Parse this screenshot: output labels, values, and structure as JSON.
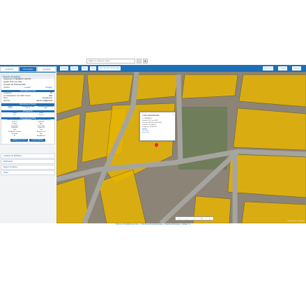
{
  "header": {
    "search_placeholder": "Digite um endereço, bairro...",
    "search_icon": "search-icon",
    "target_icon": "crosshair-icon"
  },
  "sidebar": {
    "tabs": [
      {
        "label": "GeoPortal"
      },
      {
        "label": "Informações"
      },
      {
        "label": "Consultas"
      }
    ],
    "panel_title": "Cadastro Imobiliário",
    "summary": [
      "Loteamento: LOTEAMENTO CENTRO",
      "Quadra: 0279, Lote: 0022",
      "Inscrição: 001.0279.0022.0000"
    ],
    "tools_label": "Cadastro",
    "tool_links": [
      "Localizar",
      "Visualizar"
    ],
    "info_head": "Informações do Lote",
    "info_rows": [
      {
        "label": "Logradouro",
        "value": "AV"
      },
      {
        "label": "AV PRESIDENTE COLOMBO SOUZA",
        "value": "1000"
      },
      {
        "label": "Bairro",
        "value": "Complemento"
      },
      {
        "label": "CENTRO",
        "value": "SALAS COMERCIAIS"
      }
    ],
    "dims_head": "Dimensões do Terreno",
    "dims_cols": [
      "Área",
      "Testada Principal",
      "Testadas Secundárias"
    ],
    "dims_vals": [
      "12450,5",
      "130,1",
      "48,8"
    ],
    "zone_head": "Zoneamento",
    "zone_cols": [
      "Zona",
      "Setor"
    ],
    "zone_vals": [
      "ZC1",
      "Central"
    ],
    "build_head": "Informações Prediais",
    "build_cols": [
      "Área construída (m²)",
      "Área Total Construída (m²)"
    ],
    "build_rows": [
      [
        "4758,77",
        "4860,95"
      ],
      [
        "Padrão",
        "Alto"
      ],
      [
        "Ocupação",
        "Construído"
      ],
      [
        "Utilização",
        "Comercial"
      ],
      [
        "Tipo",
        "Loja"
      ],
      [
        "Estado de Conserv.",
        "Regular 0,70"
      ],
      [
        "Elevador",
        "Sim"
      ],
      [
        "Ar",
        "ALVARÁ OK"
      ]
    ],
    "buttons": [
      "Detalhes do imóvel",
      "Imprimir Boletim"
    ],
    "accordion": [
      "Cadastro de Mobiliário",
      "Edificações",
      "Mapas Temáticos",
      "Rotas"
    ]
  },
  "map": {
    "tools": [
      "Imagem",
      "Satélite",
      "Mapa",
      "Ruas",
      "INDICADORES MUNICIPAIS"
    ],
    "right_tools": [
      "Vista aérea",
      "Camadas",
      "Legenda"
    ],
    "attribution": "Leaflet | Dados © Prefeitura",
    "popup": {
      "title": "Lote selecionado",
      "lines": [
        "LOTEAMENTO",
        "Quadra 0279, Lote 0022",
        "Inscrição 001.0279.0022.0000",
        "Latitude -23.1523451",
        "Longitude -45.8807711"
      ],
      "links": [
        "Ampliar",
        "Ver Ficha",
        "Street View"
      ]
    },
    "zoom": [
      "+",
      "−",
      "⌂",
      "↻",
      "⤢"
    ]
  },
  "footer": {
    "text": "Termos e Condições de Uso - © 2018 GeoPortal Municipal - Prefeitura Municipal - Versão 2.1"
  },
  "colors": {
    "primary": "#1d6fb8",
    "parcel": "#e6b400",
    "road": "#9b9a96"
  }
}
